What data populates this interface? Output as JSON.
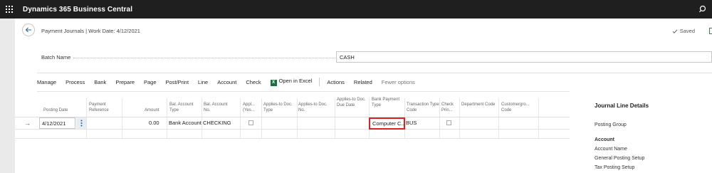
{
  "app": {
    "title": "Dynamics 365 Business Central"
  },
  "page": {
    "title": "Payment Journals | Work Date: 4/12/2021",
    "saved_status": "Saved"
  },
  "batch": {
    "label": "Batch Name",
    "value": "CASH"
  },
  "actions": [
    "Manage",
    "Process",
    "Bank",
    "Prepare",
    "Page",
    "Post/Print",
    "Line",
    "Account",
    "Check"
  ],
  "open_in_excel": "Open in Excel",
  "actions2": [
    "Actions",
    "Related"
  ],
  "fewer_options": "Fewer options",
  "columns": [
    "Posting Date",
    "Payment Reference",
    "Amount",
    "Bal. Account Type",
    "Bal. Account No.",
    "Appl... (Yes...",
    "Applies-to Doc. Type",
    "Applies-to Doc. No.",
    "Applies-to Doc. Due Date",
    "Bank Payment Type",
    "Transaction Type Code",
    "Check Prin...",
    "Department Code",
    "Customergro... Code"
  ],
  "row": {
    "posting_date": "4/12/2021",
    "amount": "0.00",
    "bal_account_type": "Bank Account",
    "bal_account_no": "CHECKING",
    "bank_payment_type": "Computer C...",
    "transaction_type_code": "BUS"
  },
  "factbox": {
    "title": "Journal Line Details",
    "posting_group": "Posting Group",
    "account_header": "Account",
    "items": [
      "Account Name",
      "General Posting Setup",
      "Tax Posting Setup"
    ]
  },
  "colors": {
    "topbar": "#1f1f1f",
    "highlight": "#e02020",
    "excel": "#1d6f42"
  }
}
